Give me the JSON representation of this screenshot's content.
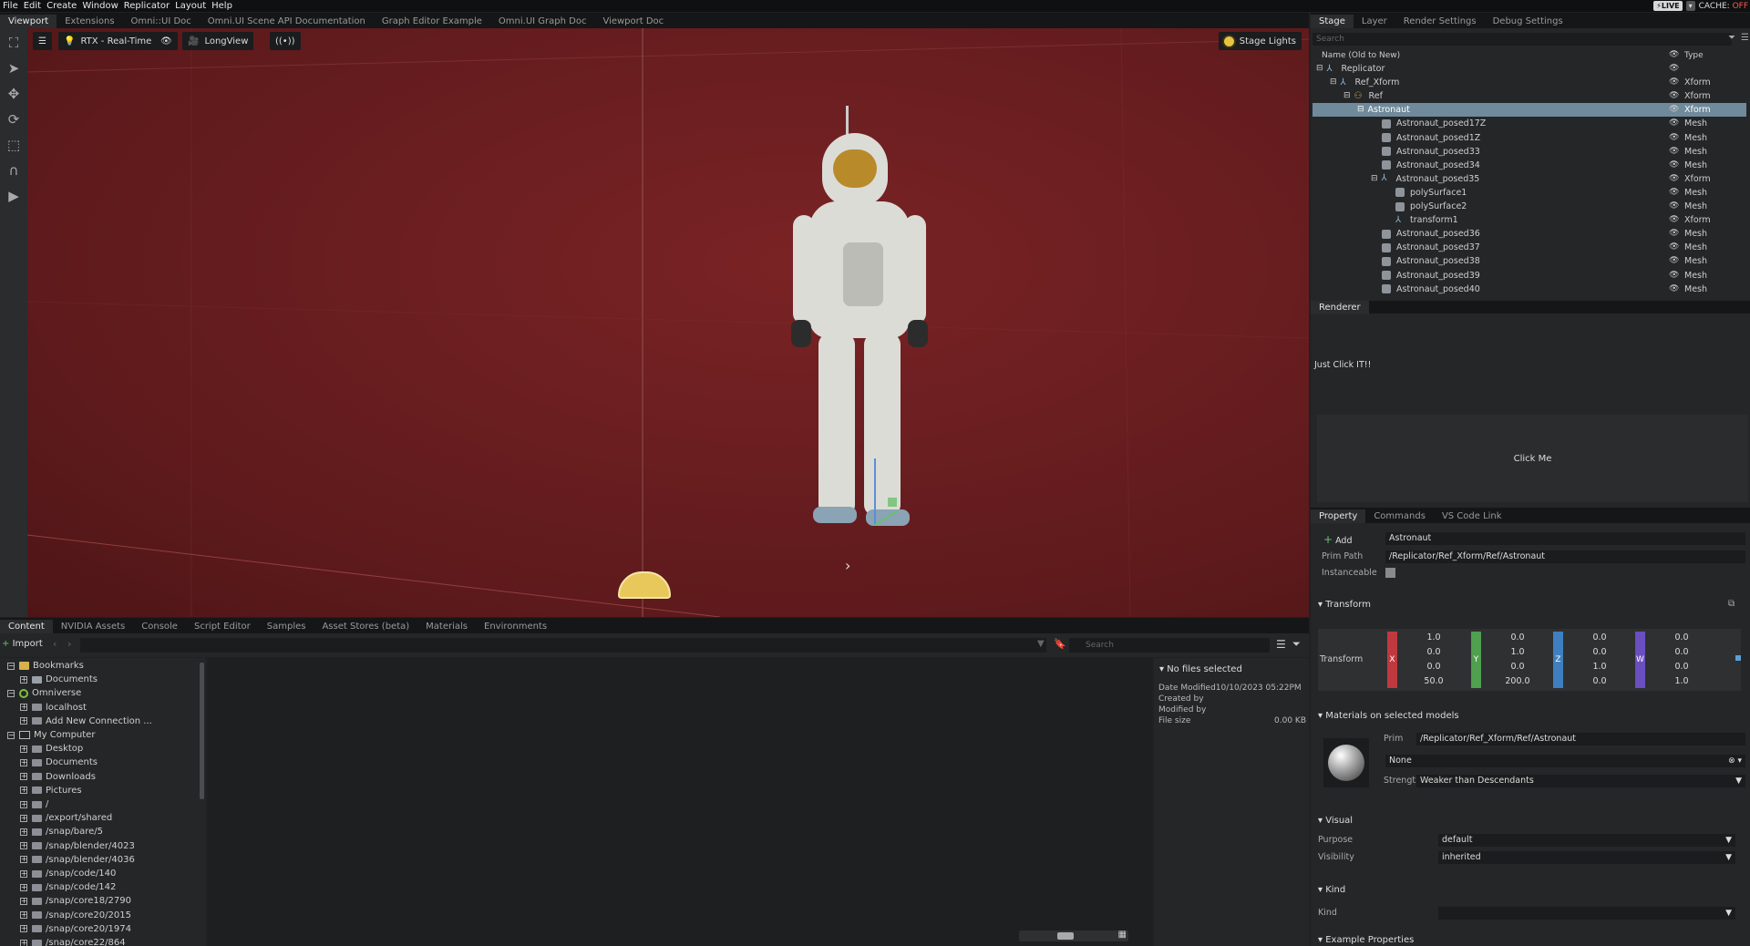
{
  "menubar": {
    "items": [
      "File",
      "Edit",
      "Create",
      "Window",
      "Replicator",
      "Layout",
      "Help"
    ],
    "live_label": "LIVE",
    "cache_label": "CACHE:",
    "cache_state": "OFF"
  },
  "viewport_tabs": [
    "Viewport",
    "Extensions",
    "Omni::UI Doc",
    "Omni.UI Scene API Documentation",
    "Graph Editor Example",
    "Omni.UI Graph Doc",
    "Viewport Doc"
  ],
  "viewport": {
    "renderer_label": "RTX - Real-Time",
    "camera_label": "LongView",
    "stage_lights_label": "Stage Lights"
  },
  "content_tabs": [
    "Content",
    "NVIDIA Assets",
    "Console",
    "Script Editor",
    "Samples",
    "Asset Stores (beta)",
    "Materials",
    "Environments"
  ],
  "content": {
    "import_label": "Import",
    "search_placeholder": "Search",
    "tree": [
      {
        "label": "Bookmarks",
        "indent": 0,
        "icon": "bookmark"
      },
      {
        "label": "Documents",
        "indent": 1,
        "icon": "folder"
      },
      {
        "label": "Omniverse",
        "indent": 0,
        "icon": "omniverse"
      },
      {
        "label": "localhost",
        "indent": 1,
        "icon": "drive"
      },
      {
        "label": "Add New Connection ...",
        "indent": 1,
        "icon": "drive"
      },
      {
        "label": "My Computer",
        "indent": 0,
        "icon": "computer"
      },
      {
        "label": "Desktop",
        "indent": 1,
        "icon": "drive"
      },
      {
        "label": "Documents",
        "indent": 1,
        "icon": "drive"
      },
      {
        "label": "Downloads",
        "indent": 1,
        "icon": "drive"
      },
      {
        "label": "Pictures",
        "indent": 1,
        "icon": "drive"
      },
      {
        "label": "/",
        "indent": 1,
        "icon": "drive"
      },
      {
        "label": "/export/shared",
        "indent": 1,
        "icon": "drive"
      },
      {
        "label": "/snap/bare/5",
        "indent": 1,
        "icon": "drive"
      },
      {
        "label": "/snap/blender/4023",
        "indent": 1,
        "icon": "drive"
      },
      {
        "label": "/snap/blender/4036",
        "indent": 1,
        "icon": "drive"
      },
      {
        "label": "/snap/code/140",
        "indent": 1,
        "icon": "drive"
      },
      {
        "label": "/snap/code/142",
        "indent": 1,
        "icon": "drive"
      },
      {
        "label": "/snap/core18/2790",
        "indent": 1,
        "icon": "drive"
      },
      {
        "label": "/snap/core20/2015",
        "indent": 1,
        "icon": "drive"
      },
      {
        "label": "/snap/core20/1974",
        "indent": 1,
        "icon": "drive"
      },
      {
        "label": "/snap/core22/864",
        "indent": 1,
        "icon": "drive"
      }
    ],
    "file_info": {
      "header": "No files selected",
      "date_modified_label": "Date Modified",
      "date_modified_value": "10/10/2023 05:22PM",
      "created_by_label": "Created by",
      "modified_by_label": "Modified by",
      "file_size_label": "File size",
      "file_size_value": "0.00 KB"
    }
  },
  "stage_tabs": [
    "Stage",
    "Layer",
    "Render Settings",
    "Debug Settings"
  ],
  "stage": {
    "search_placeholder": "Search",
    "col_name": "Name (Old to New)",
    "col_type": "Type",
    "rows": [
      {
        "name": "Replicator",
        "type": "",
        "depth": 0,
        "icon": "xform",
        "expand": "-"
      },
      {
        "name": "Ref_Xform",
        "type": "Xform",
        "depth": 1,
        "icon": "xform",
        "expand": "-"
      },
      {
        "name": "Ref",
        "type": "Xform",
        "depth": 2,
        "icon": "ref",
        "expand": "-"
      },
      {
        "name": "Astronaut",
        "type": "Xform",
        "depth": 3,
        "icon": "none",
        "expand": "-",
        "selected": true
      },
      {
        "name": "Astronaut_posed17Z",
        "type": "Mesh",
        "depth": 4,
        "icon": "mesh"
      },
      {
        "name": "Astronaut_posed1Z",
        "type": "Mesh",
        "depth": 4,
        "icon": "mesh"
      },
      {
        "name": "Astronaut_posed33",
        "type": "Mesh",
        "depth": 4,
        "icon": "mesh"
      },
      {
        "name": "Astronaut_posed34",
        "type": "Mesh",
        "depth": 4,
        "icon": "mesh"
      },
      {
        "name": "Astronaut_posed35",
        "type": "Xform",
        "depth": 4,
        "icon": "xform",
        "expand": "-"
      },
      {
        "name": "polySurface1",
        "type": "Mesh",
        "depth": 5,
        "icon": "mesh"
      },
      {
        "name": "polySurface2",
        "type": "Mesh",
        "depth": 5,
        "icon": "mesh"
      },
      {
        "name": "transform1",
        "type": "Xform",
        "depth": 5,
        "icon": "xform"
      },
      {
        "name": "Astronaut_posed36",
        "type": "Mesh",
        "depth": 4,
        "icon": "mesh"
      },
      {
        "name": "Astronaut_posed37",
        "type": "Mesh",
        "depth": 4,
        "icon": "mesh"
      },
      {
        "name": "Astronaut_posed38",
        "type": "Mesh",
        "depth": 4,
        "icon": "mesh"
      },
      {
        "name": "Astronaut_posed39",
        "type": "Mesh",
        "depth": 4,
        "icon": "mesh"
      },
      {
        "name": "Astronaut_posed40",
        "type": "Mesh",
        "depth": 4,
        "icon": "mesh"
      }
    ]
  },
  "renderer": {
    "tab": "Renderer",
    "text": "Just Click IT!!",
    "button_label": "Click Me"
  },
  "property_tabs": [
    "Property",
    "Commands",
    "VS Code Link"
  ],
  "property": {
    "add_label": "Add",
    "name_value": "Astronaut",
    "prim_path_label": "Prim Path",
    "prim_path_value": "/Replicator/Ref_Xform/Ref/Astronaut",
    "instanceable_label": "Instanceable",
    "transform_section": "Transform",
    "transform_label": "Transform",
    "axes": [
      "X",
      "Y",
      "Z",
      "W"
    ],
    "matrix": [
      [
        "1.0",
        "0.0",
        "0.0",
        "0.0"
      ],
      [
        "0.0",
        "1.0",
        "0.0",
        "0.0"
      ],
      [
        "0.0",
        "0.0",
        "1.0",
        "0.0"
      ],
      [
        "50.0",
        "200.0",
        "0.0",
        "1.0"
      ]
    ],
    "materials_section": "Materials on selected models",
    "mat_prim_label": "Prim",
    "mat_prim_value": "/Replicator/Ref_Xform/Ref/Astronaut",
    "mat_value": "None",
    "strength_label": "Strength",
    "strength_value": "Weaker than Descendants",
    "visual_section": "Visual",
    "purpose_label": "Purpose",
    "purpose_value": "default",
    "visibility_label": "Visibility",
    "visibility_value": "inherited",
    "kind_section": "Kind",
    "kind_label": "Kind",
    "kind_value": "",
    "example_section": "Example Properties"
  },
  "colors": {
    "viewport_bg": "#6a1c1e",
    "selection": "#6f8a9a",
    "axis_x": "#c0393f",
    "axis_y": "#4fa04f",
    "axis_z": "#3f7fc0",
    "axis_w": "#6a4fc0"
  }
}
